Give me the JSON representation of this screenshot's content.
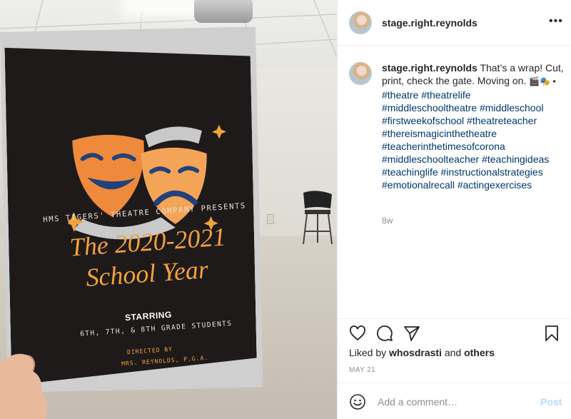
{
  "post": {
    "username": "stage.right.reynolds",
    "more_icon": "more-options-icon",
    "caption_text": "That’s a wrap! Cut, print, check the gate. Moving on.",
    "caption_emojis": "🎬🎭 •",
    "hashtags": [
      "#theatre #theatrelife",
      "#middleschooltheatre #middleschool",
      "#firstweekofschool #theatreteacher",
      "#thereismagicinthetheatre",
      "#teacherinthetimesofcorona",
      "#middleschoolteacher #teachingideas",
      "#teachinglife #instructionalstrategies",
      "#emotionalrecall #actingexercises"
    ],
    "time_ago": "8w",
    "likes_prefix": "Liked by",
    "liked_by_user": "whosdrasti",
    "likes_and": "and",
    "likes_others": "others",
    "date": "MAY 21",
    "comment_placeholder": "Add a comment…",
    "post_label": "Post"
  },
  "poster": {
    "presents": "HMS TIGERS' THEATRE COMPANY PRESENTS",
    "title_line1": "The 2020-2021",
    "title_line2": "School Year",
    "starring": "STARRING",
    "students": "6TH, 7TH, & 8TH GRADE STUDENTS",
    "directed_by": "DIRECTED BY",
    "director": "MRS. REYNOLDS, P.G.A."
  },
  "colors": {
    "poster_bg": "#1f1a1a",
    "poster_accent": "#f2a23a",
    "hashtag": "#00376b",
    "post_button": "#b3dbff"
  }
}
